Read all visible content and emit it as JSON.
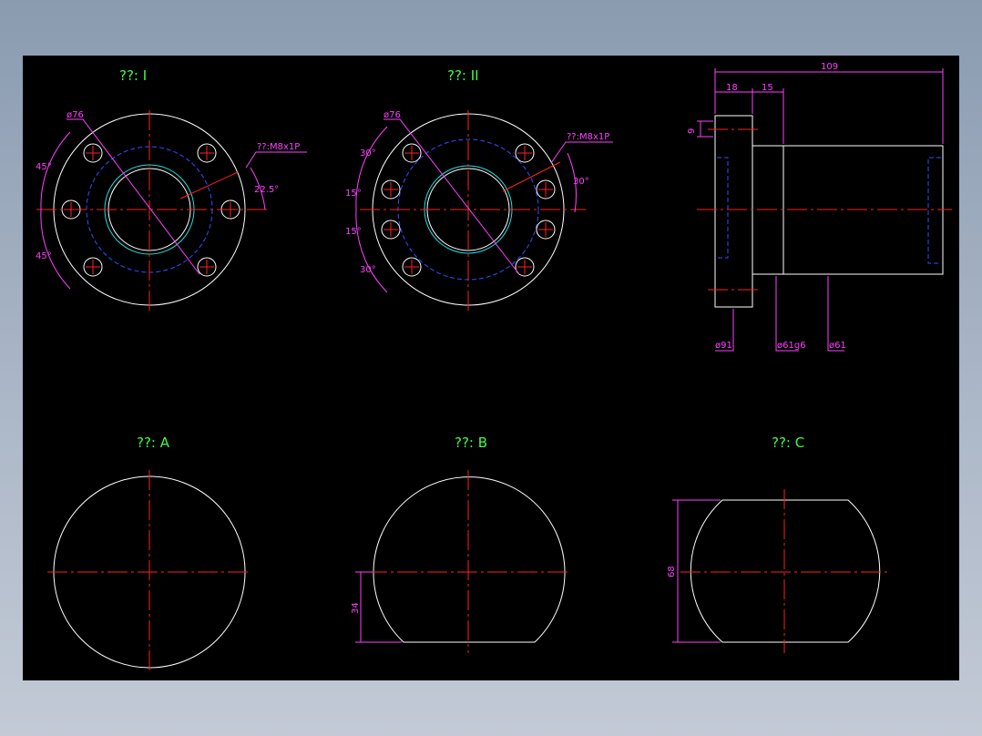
{
  "view_titles": {
    "view1": "??: I",
    "view2": "??: II",
    "view3": "??: A",
    "view4": "??: B",
    "view5": "??: C"
  },
  "view1_dims": {
    "dia": "ø76",
    "thread": "??:M8x1P",
    "ang_top": "45°",
    "ang_bot": "45°",
    "ang_right": "22.5°"
  },
  "view2_dims": {
    "dia": "ø76",
    "thread": "??:M8x1P",
    "a30_top": "30°",
    "a15_up": "15°",
    "a15_dn": "15°",
    "a30_bot": "30°",
    "a30_right": "30°"
  },
  "side_dims": {
    "len": "109",
    "flange": "18",
    "step": "15",
    "h9": "9",
    "d91": "ø91",
    "d61g6": "ø61g6",
    "d61": "ø61"
  },
  "section_dims": {
    "b34": "34",
    "c68": "68"
  },
  "colors": {
    "background": "#000000",
    "text_labels": "#3fff3f",
    "dimensions": "#ff40ff",
    "centerlines": "#ff2020",
    "hidden": "#3050ff",
    "outline": "#ffffff"
  }
}
